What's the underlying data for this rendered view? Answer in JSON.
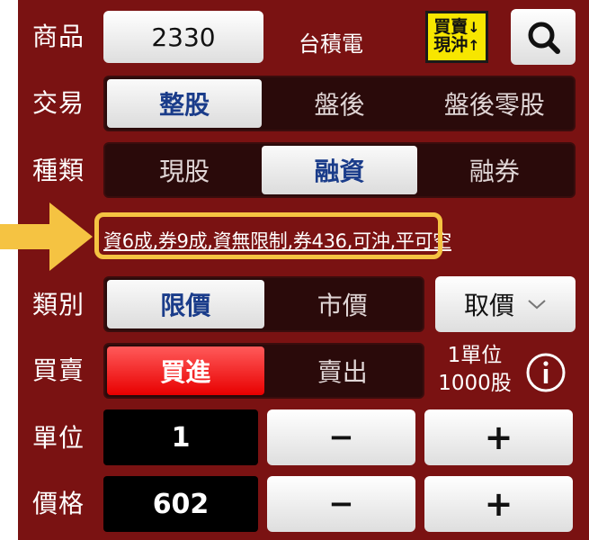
{
  "product": {
    "label": "商品",
    "code": "2330",
    "name": "台積電",
    "badge_top": "買賣",
    "badge_bottom": "現沖"
  },
  "trade": {
    "label": "交易",
    "options": [
      "整股",
      "盤後",
      "盤後零股"
    ],
    "selected": 0
  },
  "kind": {
    "label": "種類",
    "options": [
      "現股",
      "融資",
      "融券"
    ],
    "selected": 1
  },
  "info_text": "資6成,券9成,資無限制,券436,可沖,平可空",
  "category": {
    "label": "類別",
    "options": [
      "限價",
      "市價"
    ],
    "selected": 0,
    "dropdown_label": "取價"
  },
  "side": {
    "label": "買賣",
    "options": [
      "買進",
      "賣出"
    ],
    "selected": 0,
    "unit_info_line1": "1單位",
    "unit_info_line2": "1000股"
  },
  "units": {
    "label": "單位",
    "value": "1"
  },
  "price": {
    "label": "價格",
    "value": "602"
  },
  "stepper": {
    "minus": "−",
    "plus": "+"
  },
  "colors": {
    "panel": "#7a1212",
    "highlight": "#f5c342",
    "buy_red": "#e80000",
    "badge_yellow": "#f7e600"
  }
}
